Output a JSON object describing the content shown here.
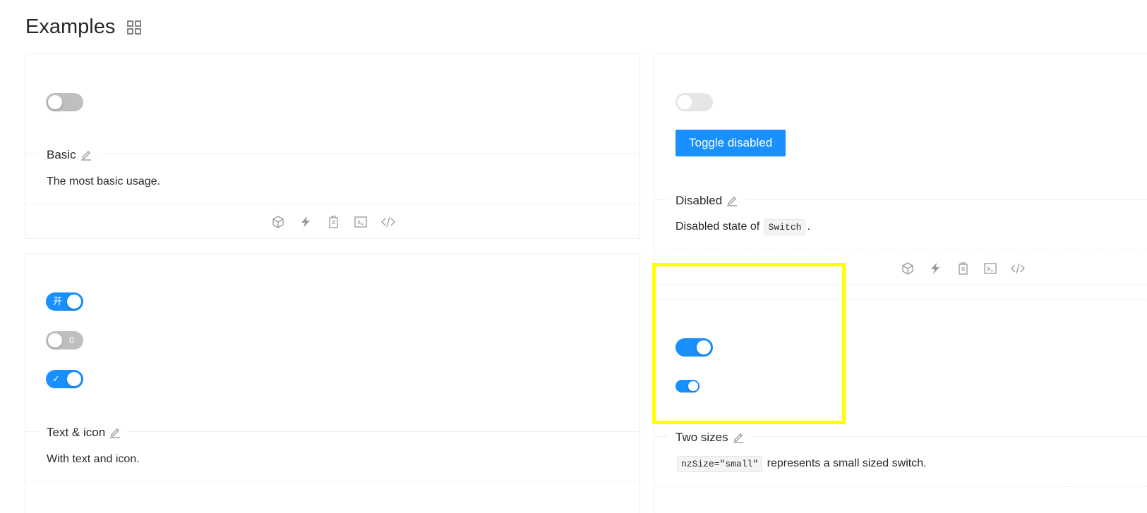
{
  "header": {
    "title": "Examples",
    "expand_icon": "grid-icon"
  },
  "cards": {
    "basic": {
      "title": "Basic",
      "description": "The most basic usage.",
      "switch_checked": false
    },
    "text_icon": {
      "title": "Text & icon",
      "description": "With text and icon.",
      "switches": [
        {
          "checked": true,
          "text": "开"
        },
        {
          "checked": false,
          "text": "0"
        },
        {
          "checked": true,
          "text": "✓"
        }
      ]
    },
    "disabled": {
      "title": "Disabled",
      "desc_before": "Disabled state of",
      "desc_code": "Switch",
      "desc_after": ".",
      "button_label": "Toggle disabled",
      "switch_checked": false,
      "switch_disabled": true
    },
    "two_sizes": {
      "title": "Two sizes",
      "desc_code": "nzSize=\"small\"",
      "desc_after": "represents a small sized switch.",
      "switches": [
        {
          "size": "default",
          "checked": true
        },
        {
          "size": "small",
          "checked": true
        }
      ]
    }
  },
  "action_icons": [
    "codesandbox-icon",
    "stackblitz-icon",
    "copy-icon",
    "terminal-icon",
    "code-icon"
  ],
  "colors": {
    "primary": "#1890ff",
    "switch_off": "#bfbfbf",
    "switch_disabled_off": "#e6e6e6",
    "highlight": "#ffff00"
  }
}
